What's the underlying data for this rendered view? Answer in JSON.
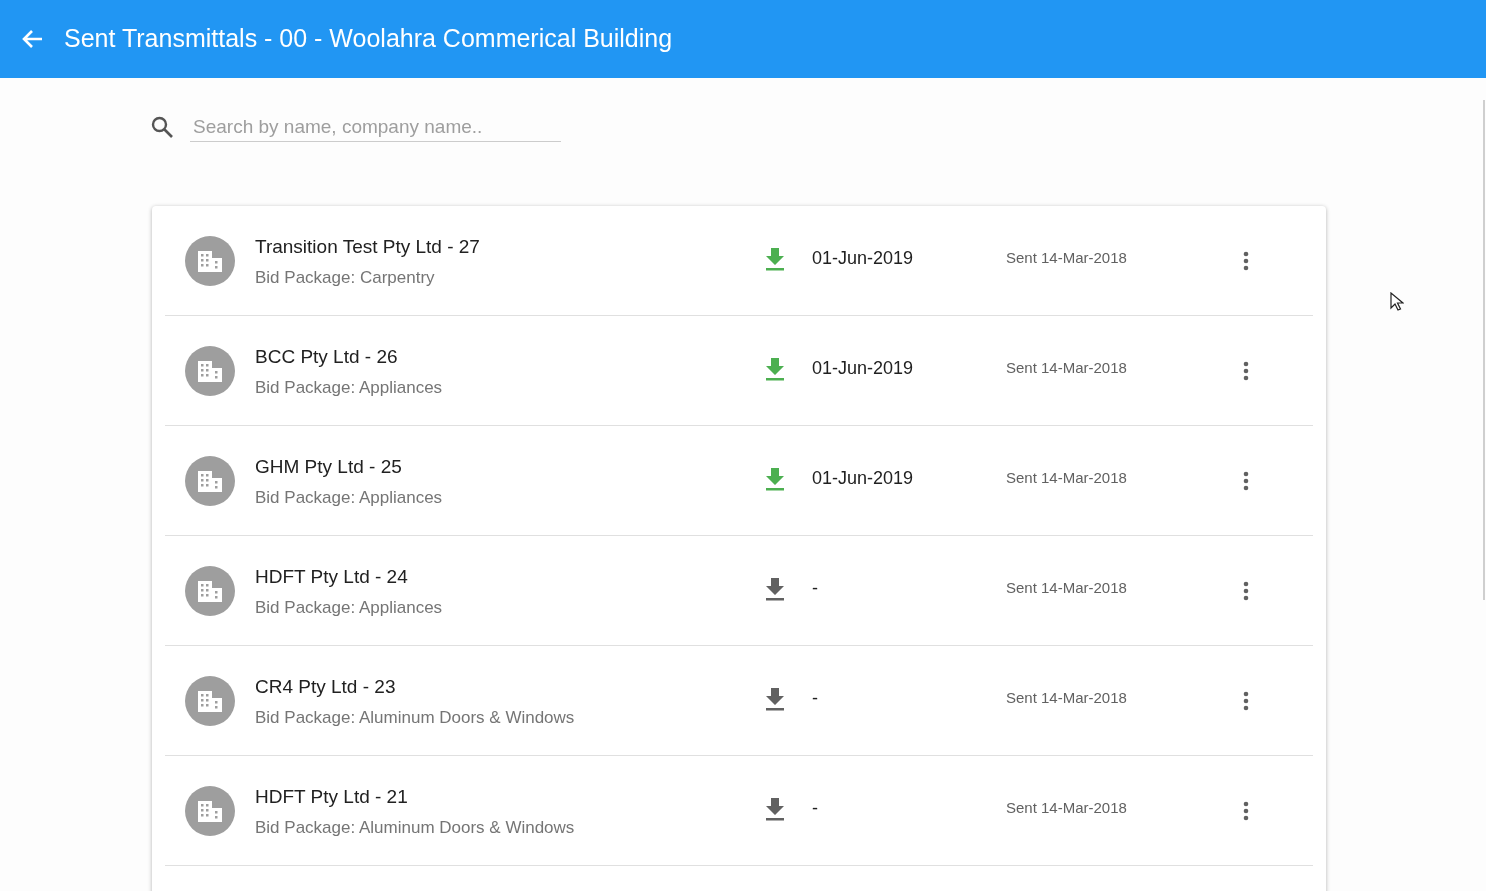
{
  "header": {
    "title": "Sent Transmittals - 00 - Woolahra Commerical Building"
  },
  "search": {
    "placeholder": "Search by name, company name.."
  },
  "transmittals": [
    {
      "name": "Transition Test Pty Ltd - 27",
      "package": "Bid Package: Carpentry",
      "downloaded": true,
      "date": "01-Jun-2019",
      "sent": "Sent 14-Mar-2018"
    },
    {
      "name": "BCC Pty Ltd - 26",
      "package": "Bid Package: Appliances",
      "downloaded": true,
      "date": "01-Jun-2019",
      "sent": "Sent 14-Mar-2018"
    },
    {
      "name": "GHM Pty Ltd - 25",
      "package": "Bid Package: Appliances",
      "downloaded": true,
      "date": "01-Jun-2019",
      "sent": "Sent 14-Mar-2018"
    },
    {
      "name": "HDFT Pty Ltd - 24",
      "package": "Bid Package: Appliances",
      "downloaded": false,
      "date": "-",
      "sent": "Sent 14-Mar-2018"
    },
    {
      "name": "CR4 Pty Ltd - 23",
      "package": "Bid Package: Aluminum Doors & Windows",
      "downloaded": false,
      "date": "-",
      "sent": "Sent 14-Mar-2018"
    },
    {
      "name": "HDFT Pty Ltd - 21",
      "package": "Bid Package: Aluminum Doors & Windows",
      "downloaded": false,
      "date": "-",
      "sent": "Sent 14-Mar-2018"
    }
  ]
}
